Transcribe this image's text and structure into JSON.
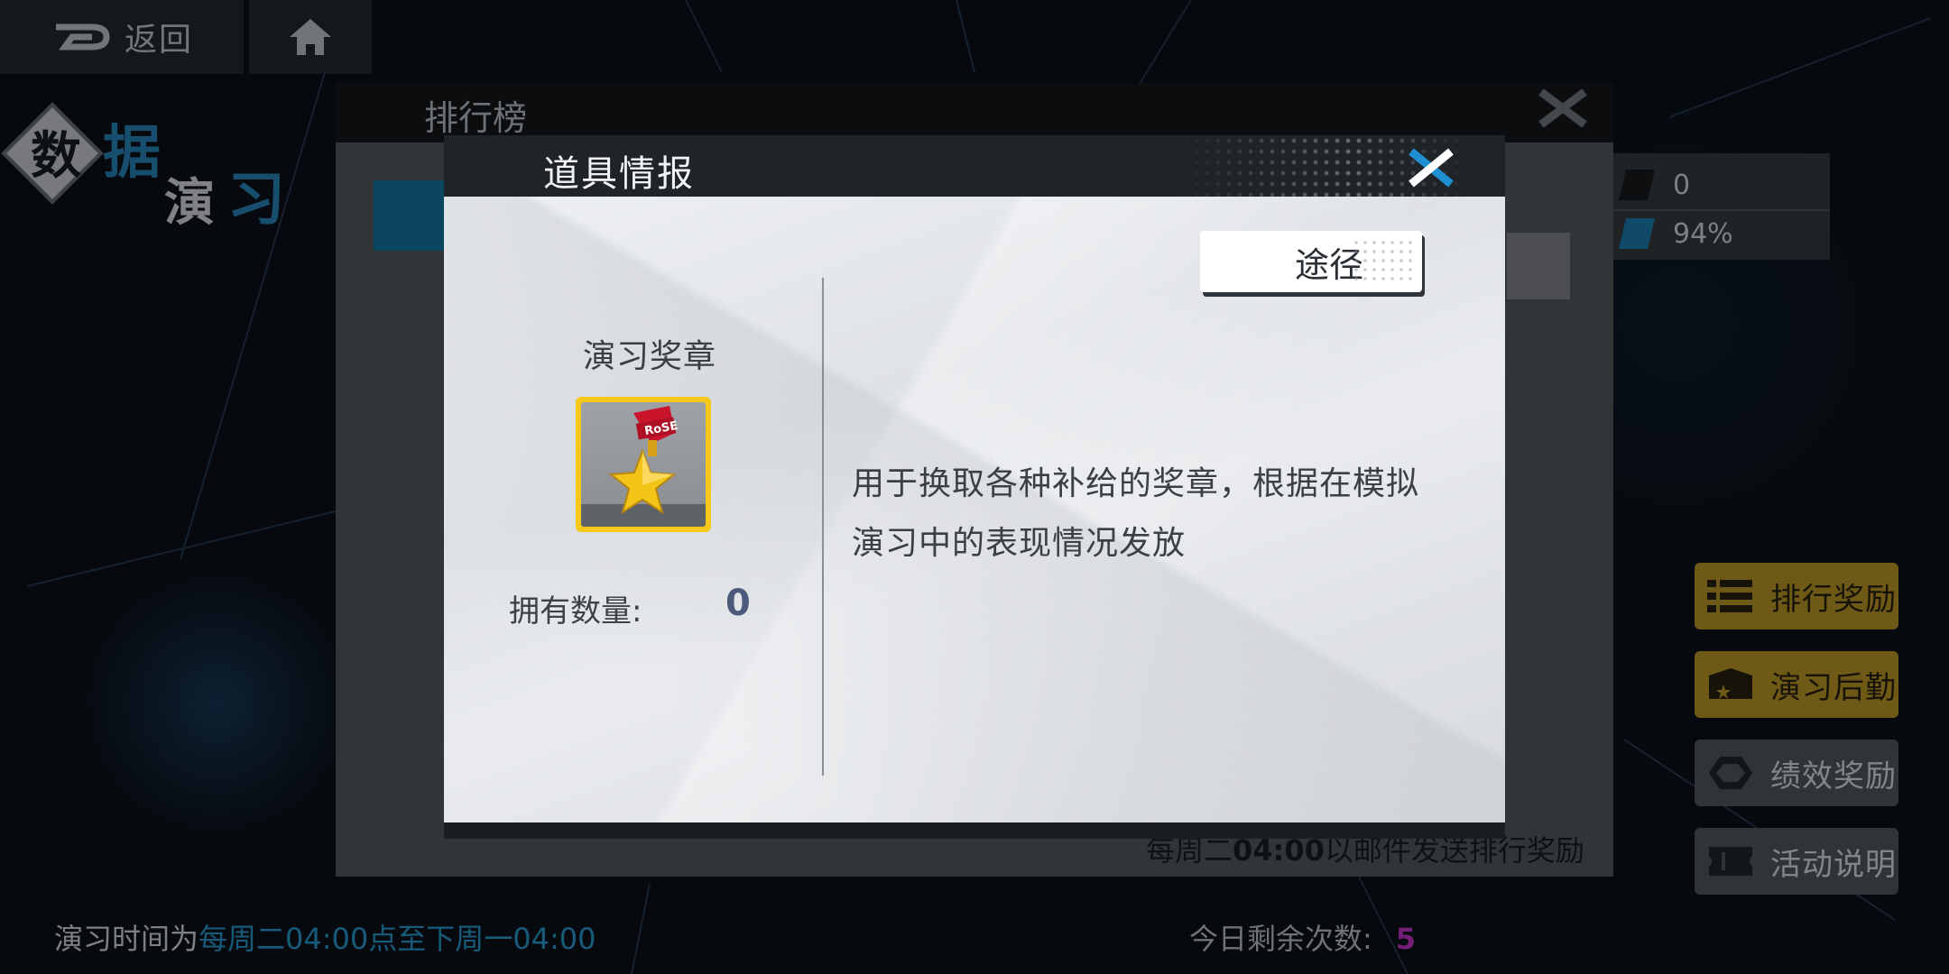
{
  "nav": {
    "back_label": "返回",
    "home_icon": "home-icon",
    "back_icon": "back-arrow-icon"
  },
  "logo": {
    "line1_a": "数",
    "line1_b": "据",
    "line2_a": "演",
    "line2_b": "习"
  },
  "ranking_panel": {
    "title": "排行榜",
    "footer_prefix": "每周二",
    "footer_time": "04:00",
    "footer_suffix": "以邮件发送排行奖励"
  },
  "stats": {
    "value1": "0",
    "value2": "94%"
  },
  "side_buttons": [
    {
      "label": "排行奖励",
      "icon": "list-icon",
      "style": "yellow"
    },
    {
      "label": "演习后勤",
      "icon": "box-star-icon",
      "style": "yellow"
    },
    {
      "label": "绩效奖励",
      "icon": "hexagon-icon",
      "style": "grey"
    },
    {
      "label": "活动说明",
      "icon": "ticket-icon",
      "style": "grey"
    }
  ],
  "bottom": {
    "left_prefix": "演习时间为",
    "left_highlight": "每周二04:00点至下周一04:00",
    "right_label": "今日剩余次数:",
    "right_value": "5"
  },
  "modal": {
    "title": "道具情报",
    "route_label": "途径",
    "item_name": "演习奖章",
    "item_icon": "medal-star-icon",
    "item_icon_ribbon_text": "RoSE",
    "own_label": "拥有数量:",
    "own_value": "0",
    "description": "用于换取各种补给的奖章，根据在模拟演习中的表现情况发放"
  },
  "colors": {
    "accent_blue": "#2aa5de",
    "button_yellow": "#caa22a",
    "remaining_count": "#d23ad7",
    "icon_gold": "#f5c91b"
  }
}
